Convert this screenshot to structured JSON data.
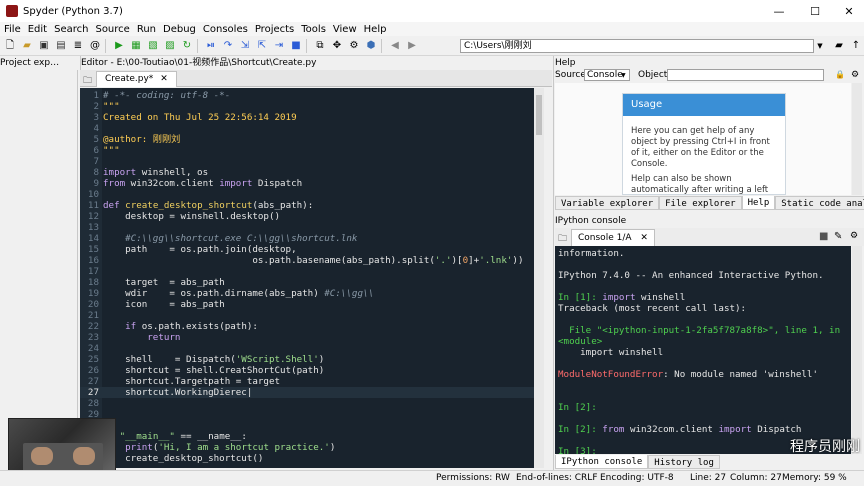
{
  "window": {
    "title": "Spyder (Python 3.7)",
    "min": "—",
    "max": "☐",
    "close": "✕"
  },
  "menu": [
    "File",
    "Edit",
    "Search",
    "Source",
    "Run",
    "Debug",
    "Consoles",
    "Projects",
    "Tools",
    "View",
    "Help"
  ],
  "toolbar": {
    "path": "C:\\Users\\刚刚刘"
  },
  "panes": {
    "project": "Project exp…",
    "editor": "Editor - E:\\00-Toutiao\\01-视频作品\\Shortcut\\Create.py",
    "help": "Help",
    "ipython": "IPython console"
  },
  "editor": {
    "tab": "Create.py*",
    "lines": [
      {
        "n": "1",
        "html": "<span class='c'># -*- coding: utf-8 -*-</span>"
      },
      {
        "n": "2",
        "html": "<span class='y'>\"\"\"</span>"
      },
      {
        "n": "3",
        "html": "<span class='y'>Created on Thu Jul 25 22:56:14 2019</span>"
      },
      {
        "n": "4",
        "html": ""
      },
      {
        "n": "5",
        "html": "<span class='y'>@author: 刚刚刘</span>"
      },
      {
        "n": "6",
        "html": "<span class='y'>\"\"\"</span>"
      },
      {
        "n": "7",
        "html": ""
      },
      {
        "n": "8",
        "html": "<span class='k'>import</span> winshell, os"
      },
      {
        "n": "9",
        "html": "<span class='k'>from</span> win32com.client <span class='k'>import</span> Dispatch"
      },
      {
        "n": "10",
        "html": ""
      },
      {
        "n": "11",
        "html": "<span class='k'>def</span> <span class='f'>create_desktop_shortcut</span>(abs_path):"
      },
      {
        "n": "12",
        "html": "    desktop = winshell.desktop()"
      },
      {
        "n": "13",
        "html": ""
      },
      {
        "n": "14",
        "html": "    <span class='c'>#C:\\\\gg\\\\shortcut.exe C:\\\\gg\\\\shortcut.lnk</span>"
      },
      {
        "n": "15",
        "html": "    path    = os.path.join(desktop,"
      },
      {
        "n": "16",
        "html": "                           os.path.basename(abs_path).split(<span class='s'>'.'</span>)[<span class='n'>0</span>]+<span class='s'>'.lnk'</span>))"
      },
      {
        "n": "17",
        "html": ""
      },
      {
        "n": "18",
        "html": "    target  = abs_path"
      },
      {
        "n": "19",
        "html": "    wdir    = os.path.dirname(abs_path) <span class='c'>#C:\\\\gg\\\\</span>"
      },
      {
        "n": "20",
        "html": "    icon    = abs_path"
      },
      {
        "n": "21",
        "html": ""
      },
      {
        "n": "22",
        "html": "    <span class='k'>if</span> os.path.exists(path):"
      },
      {
        "n": "23",
        "html": "        <span class='k'>return</span>"
      },
      {
        "n": "24",
        "html": ""
      },
      {
        "n": "25",
        "html": "    shell    = Dispatch(<span class='s'>'WScript.Shell'</span>)"
      },
      {
        "n": "26",
        "html": "    shortcut = shell.CreatShortCut(path)"
      },
      {
        "n": "27",
        "html": "    shortcut.Targetpath = target"
      },
      {
        "n": "27",
        "html": "    shortcut.WorkingDierec|"
      },
      {
        "n": "28",
        "html": ""
      },
      {
        "n": "29",
        "html": ""
      },
      {
        "n": "30",
        "html": ""
      },
      {
        "n": "31",
        "html": "<span class='k'>if</span> <span class='s'>\"__main__\"</span> == __name__:"
      },
      {
        "n": "32",
        "html": "    <span class='k'>print</span>(<span class='s'>'Hi, I am a shortcut practice.'</span>)"
      },
      {
        "n": "33",
        "html": "    create_desktop_shortcut()"
      }
    ]
  },
  "help": {
    "source_label": "Source",
    "source_value": "Console",
    "object_label": "Object",
    "card_title": "Usage",
    "card_p1": "Here you can get help of any object by pressing Ctrl+I in front of it, either on the Editor or the Console.",
    "card_p2": "Help can also be shown automatically after writing a left parenthesis next to an object. You can activate this",
    "tabs": [
      "Variable explorer",
      "File explorer",
      "Help",
      "Static code analysis"
    ]
  },
  "console": {
    "tab": "Console 1/A",
    "lines": [
      {
        "t": "information.",
        "cls": ""
      },
      {
        "t": "",
        "cls": ""
      },
      {
        "t": "IPython 7.4.0 -- An enhanced Interactive Python.",
        "cls": ""
      },
      {
        "t": "",
        "cls": ""
      },
      {
        "t": "<span class='cg'>In [1]:</span> <span class='k'>import</span> winshell",
        "cls": ""
      },
      {
        "t": "Traceback (most recent call last):",
        "cls": ""
      },
      {
        "t": "",
        "cls": ""
      },
      {
        "t": "  File \"&lt;ipython-input-1-2fa5f787a8f8&gt;\", line 1, in",
        "cls": "cg"
      },
      {
        "t": "&lt;module&gt;",
        "cls": "cg"
      },
      {
        "t": "    import winshell",
        "cls": ""
      },
      {
        "t": "",
        "cls": ""
      },
      {
        "t": "<span class='cr'>ModuleNotFoundError</span>: No module named 'winshell'",
        "cls": ""
      },
      {
        "t": "",
        "cls": ""
      },
      {
        "t": "",
        "cls": ""
      },
      {
        "t": "<span class='cg'>In [2]:</span>",
        "cls": ""
      },
      {
        "t": "",
        "cls": ""
      },
      {
        "t": "<span class='cg'>In [2]:</span> <span class='k'>from</span> win32com.client <span class='k'>import</span> Dispatch",
        "cls": ""
      },
      {
        "t": "",
        "cls": ""
      },
      {
        "t": "<span class='cg'>In [3]:</span>",
        "cls": ""
      }
    ],
    "tabs": [
      "IPython console",
      "History log"
    ]
  },
  "status": {
    "permissions": "Permissions: RW",
    "eol": "End-of-lines: CRLF",
    "encoding": "Encoding: UTF-8",
    "line": "Line: 27",
    "column": "Column: 27",
    "memory": "Memory: 59 %"
  },
  "watermark": "程序员刚刚"
}
